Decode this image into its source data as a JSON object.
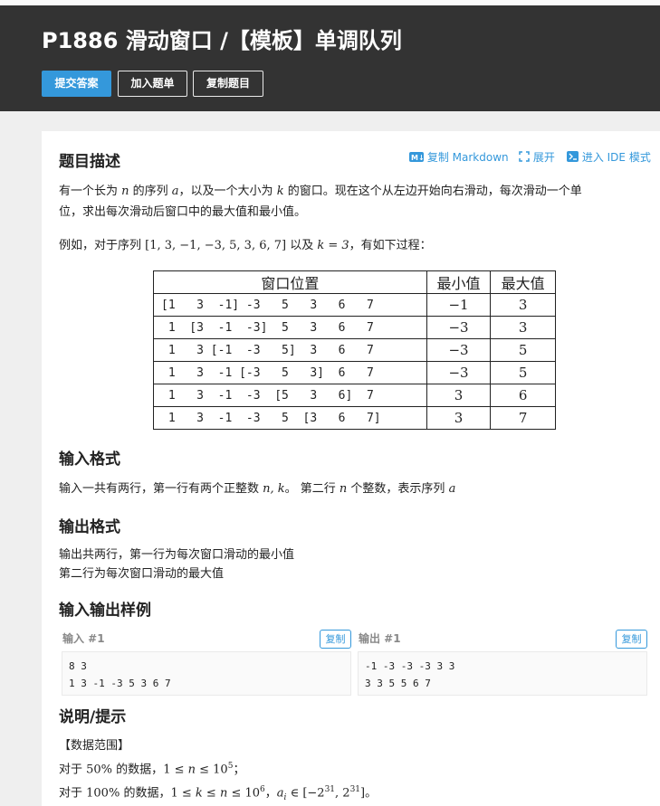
{
  "header": {
    "title": "P1886 滑动窗口 /【模板】单调队列",
    "buttons": {
      "submit": "提交答案",
      "add_list": "加入题单",
      "copy_problem": "复制题目"
    }
  },
  "actions": {
    "copy_markdown": "复制 Markdown",
    "expand": "展开",
    "ide_mode": "进入 IDE 模式"
  },
  "description": {
    "heading": "题目描述",
    "p1_a": "有一个长为 ",
    "p1_n": "n",
    "p1_b": " 的序列 ",
    "p1_a_var": "a",
    "p1_c": "，以及一个大小为 ",
    "p1_k": "k",
    "p1_d": " 的窗口。现在这个从左边开始向右滑动，每次滑动一个单",
    "p1_line2": "位，求出每次滑动后窗口中的最大值和最小值。",
    "p2_a": "例如，对于序列 ",
    "p2_seq": "[1, 3, −1, −3, 5, 3, 6, 7]",
    "p2_b": " 以及 ",
    "p2_keq": "k = 3",
    "p2_c": "，有如下过程："
  },
  "window_table": {
    "headers": [
      "窗口位置",
      "最小值",
      "最大值"
    ],
    "rows": [
      {
        "pos": "[1   3  -1] -3   5   3   6   7",
        "min": "−1",
        "max": "3"
      },
      {
        "pos": " 1  [3  -1  -3]  5   3   6   7",
        "min": "−3",
        "max": "3"
      },
      {
        "pos": " 1   3 [-1  -3   5]  3   6   7",
        "min": "−3",
        "max": "5"
      },
      {
        "pos": " 1   3  -1 [-3   5   3]  6   7",
        "min": "−3",
        "max": "5"
      },
      {
        "pos": " 1   3  -1  -3  [5   3   6]  7",
        "min": "3",
        "max": "6"
      },
      {
        "pos": " 1   3  -1  -3   5  [3   6   7]",
        "min": "3",
        "max": "7"
      }
    ]
  },
  "input_format": {
    "heading": "输入格式",
    "text_a": "输入一共有两行，第一行有两个正整数 ",
    "text_nk": "n, k",
    "text_b": "。 第二行 ",
    "text_n": "n",
    "text_c": " 个整数，表示序列 ",
    "text_a_var": "a"
  },
  "output_format": {
    "heading": "输出格式",
    "line1": "输出共两行，第一行为每次窗口滑动的最小值",
    "line2": "第二行为每次窗口滑动的最大值"
  },
  "samples": {
    "heading": "输入输出样例",
    "input_label": "输入 #1",
    "output_label": "输出 #1",
    "copy_label": "复制",
    "input_lines": [
      "8 3",
      "1 3 -1 -3 5 3 6 7"
    ],
    "output_lines": [
      "-1 -3 -3 -3 3 3",
      "3 3 5 5 6 7"
    ]
  },
  "hint": {
    "heading": "说明/提示",
    "range_title": "【数据范围】",
    "l1_a": "对于 ",
    "l1_pct": "50%",
    "l1_b": " 的数据，",
    "l1_math_a": "1 ≤ ",
    "l1_n": "n",
    "l1_math_b": " ≤ 10",
    "l1_exp": "5",
    "l1_c": "；",
    "l2_a": "对于 ",
    "l2_pct": "100%",
    "l2_b": " 的数据，",
    "l2_math_a": "1 ≤ ",
    "l2_k": "k",
    "l2_math_b": " ≤ ",
    "l2_n": "n",
    "l2_math_c": " ≤ 10",
    "l2_exp": "6",
    "l2_c": "，",
    "l2_ai": "a",
    "l2_i": "i",
    "l2_in": " ∈ [−2",
    "l2_e1": "31",
    "l2_comma": ", 2",
    "l2_e2": "31",
    "l2_close": "]",
    "l2_end": "。"
  },
  "colors": {
    "accent": "#3498db",
    "header_bg": "#333333",
    "page_bg": "#efefef"
  }
}
